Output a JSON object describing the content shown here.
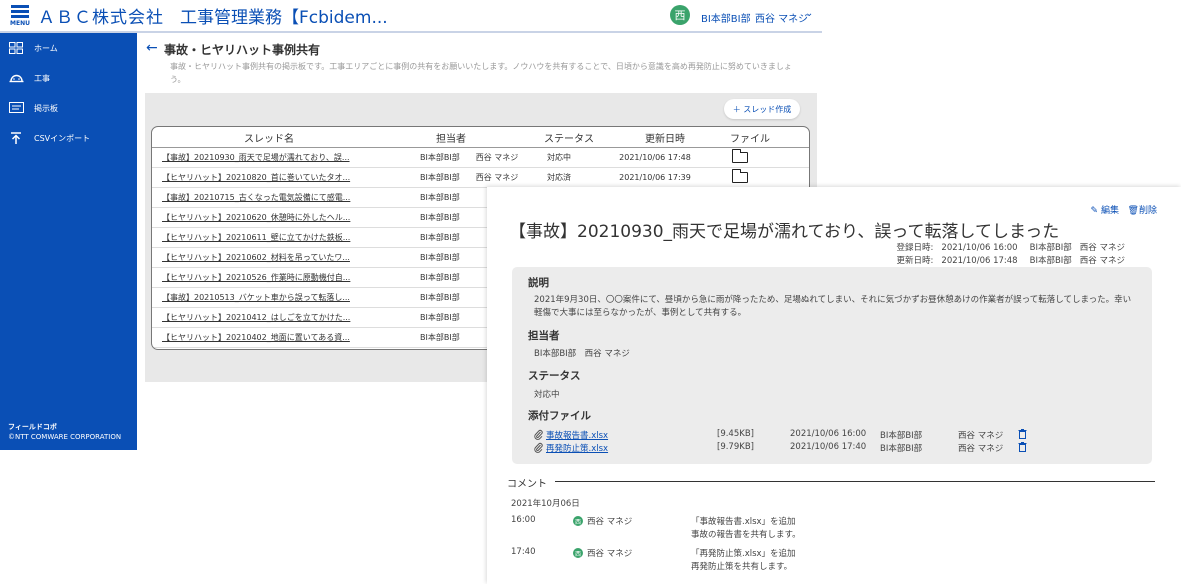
{
  "header": {
    "menu_label": "MENU",
    "company": "ＡＢＣ株式会社",
    "app_name": "工事管理業務【Fcbidem...",
    "user_avatar": "西",
    "user_dept": "BI本部BI部",
    "user_name": "西谷 マネジ",
    "chevron": "⌄"
  },
  "sidebar": {
    "items": [
      {
        "label": "ホーム",
        "icon": "grid-icon"
      },
      {
        "label": "工事",
        "icon": "helmet-icon"
      },
      {
        "label": "掲示板",
        "icon": "board-icon"
      },
      {
        "label": "CSVインポート",
        "icon": "upload-icon"
      }
    ],
    "footer_brand": "フィールドコボ",
    "footer_copy": "©NTT COMWARE CORPORATION"
  },
  "page": {
    "back": "←",
    "title": "事故・ヒヤリハット事例共有",
    "description": "事故・ヒヤリハット事例共有の掲示板です。工事エリアごとに事例の共有をお願いいたします。ノウハウを共有することで、日頃から意識を高め再発防止に努めていきましょう。",
    "create_button": "＋ スレッド作成"
  },
  "table": {
    "headers": [
      "スレッド名",
      "担当者",
      "ステータス",
      "更新日時",
      "ファイル"
    ],
    "rows": [
      {
        "title": "【事故】20210930_雨天で足場が濡れており、誤...",
        "dept": "BI本部BI部",
        "name": "西谷 マネジ",
        "status": "対応中",
        "updated": "2021/10/06 17:48",
        "file": true
      },
      {
        "title": "【ヒヤリハット】20210820_首に巻いていたタオ...",
        "dept": "BI本部BI部",
        "name": "西谷 マネジ",
        "status": "対応済",
        "updated": "2021/10/06 17:39",
        "file": true
      },
      {
        "title": "【事故】20210715_古くなった電気設備にて感電...",
        "dept": "BI本部BI部",
        "name": "",
        "status": "",
        "updated": "",
        "file": false
      },
      {
        "title": "【ヒヤリハット】20210620_休憩時に外したヘル...",
        "dept": "BI本部BI部",
        "name": "",
        "status": "",
        "updated": "",
        "file": false
      },
      {
        "title": "【ヒヤリハット】20210611_壁に立てかけた鉄板...",
        "dept": "BI本部BI部",
        "name": "",
        "status": "",
        "updated": "",
        "file": false
      },
      {
        "title": "【ヒヤリハット】20210602_材料を吊っていたワ...",
        "dept": "BI本部BI部",
        "name": "",
        "status": "",
        "updated": "",
        "file": false
      },
      {
        "title": "【ヒヤリハット】20210526_作業時に原動機付自...",
        "dept": "BI本部BI部",
        "name": "",
        "status": "",
        "updated": "",
        "file": false
      },
      {
        "title": "【事故】20210513_バケット車から誤って転落し...",
        "dept": "BI本部BI部",
        "name": "",
        "status": "",
        "updated": "",
        "file": false
      },
      {
        "title": "【ヒヤリハット】20210412_はしごを立てかけた...",
        "dept": "BI本部BI部",
        "name": "",
        "status": "",
        "updated": "",
        "file": false
      },
      {
        "title": "【ヒヤリハット】20210402_地面に置いてある資...",
        "dept": "BI本部BI部",
        "name": "",
        "status": "",
        "updated": "",
        "file": false
      }
    ]
  },
  "detail": {
    "edit": "編集",
    "delete": "削除",
    "title": "【事故】20210930_雨天で足場が濡れており、誤って転落してしまった",
    "registered_label": "登録日時:",
    "registered_at": "2021/10/06 16:00",
    "updated_label": "更新日時:",
    "updated_at": "2021/10/06 17:48",
    "author_dept": "BI本部BI部",
    "author_name": "西谷 マネジ",
    "desc_heading": "説明",
    "desc_text": "2021年9月30日、〇〇案件にて、昼頃から急に雨が降ったため、足場ぬれてしまい、それに気づかずお昼休憩あけの作業者が誤って転落してしまった。幸い軽傷で大事には至らなかったが、事例として共有する。",
    "assignee_heading": "担当者",
    "assignee": "BI本部BI部　西谷 マネジ",
    "status_heading": "ステータス",
    "status": "対応中",
    "attach_heading": "添付ファイル",
    "attachments": [
      {
        "name": "事故報告書.xlsx",
        "size": "[9.45KB]",
        "date": "2021/10/06 16:00",
        "dept": "BI本部BI部",
        "user": "西谷 マネジ"
      },
      {
        "name": "再発防止策.xlsx",
        "size": "[9.79KB]",
        "date": "2021/10/06 17:40",
        "dept": "BI本部BI部",
        "user": "西谷 マネジ"
      }
    ],
    "comments_heading": "コメント",
    "comments_date": "2021年10月06日",
    "comments": [
      {
        "time": "16:00",
        "avatar": "西",
        "user": "西谷 マネジ",
        "line1": "「事故報告書.xlsx」を追加",
        "line2": "事故の報告書を共有します。"
      },
      {
        "time": "17:40",
        "avatar": "西",
        "user": "西谷 マネジ",
        "line1": "「再発防止策.xlsx」を追加",
        "line2": "再発防止策を共有します。"
      }
    ]
  }
}
